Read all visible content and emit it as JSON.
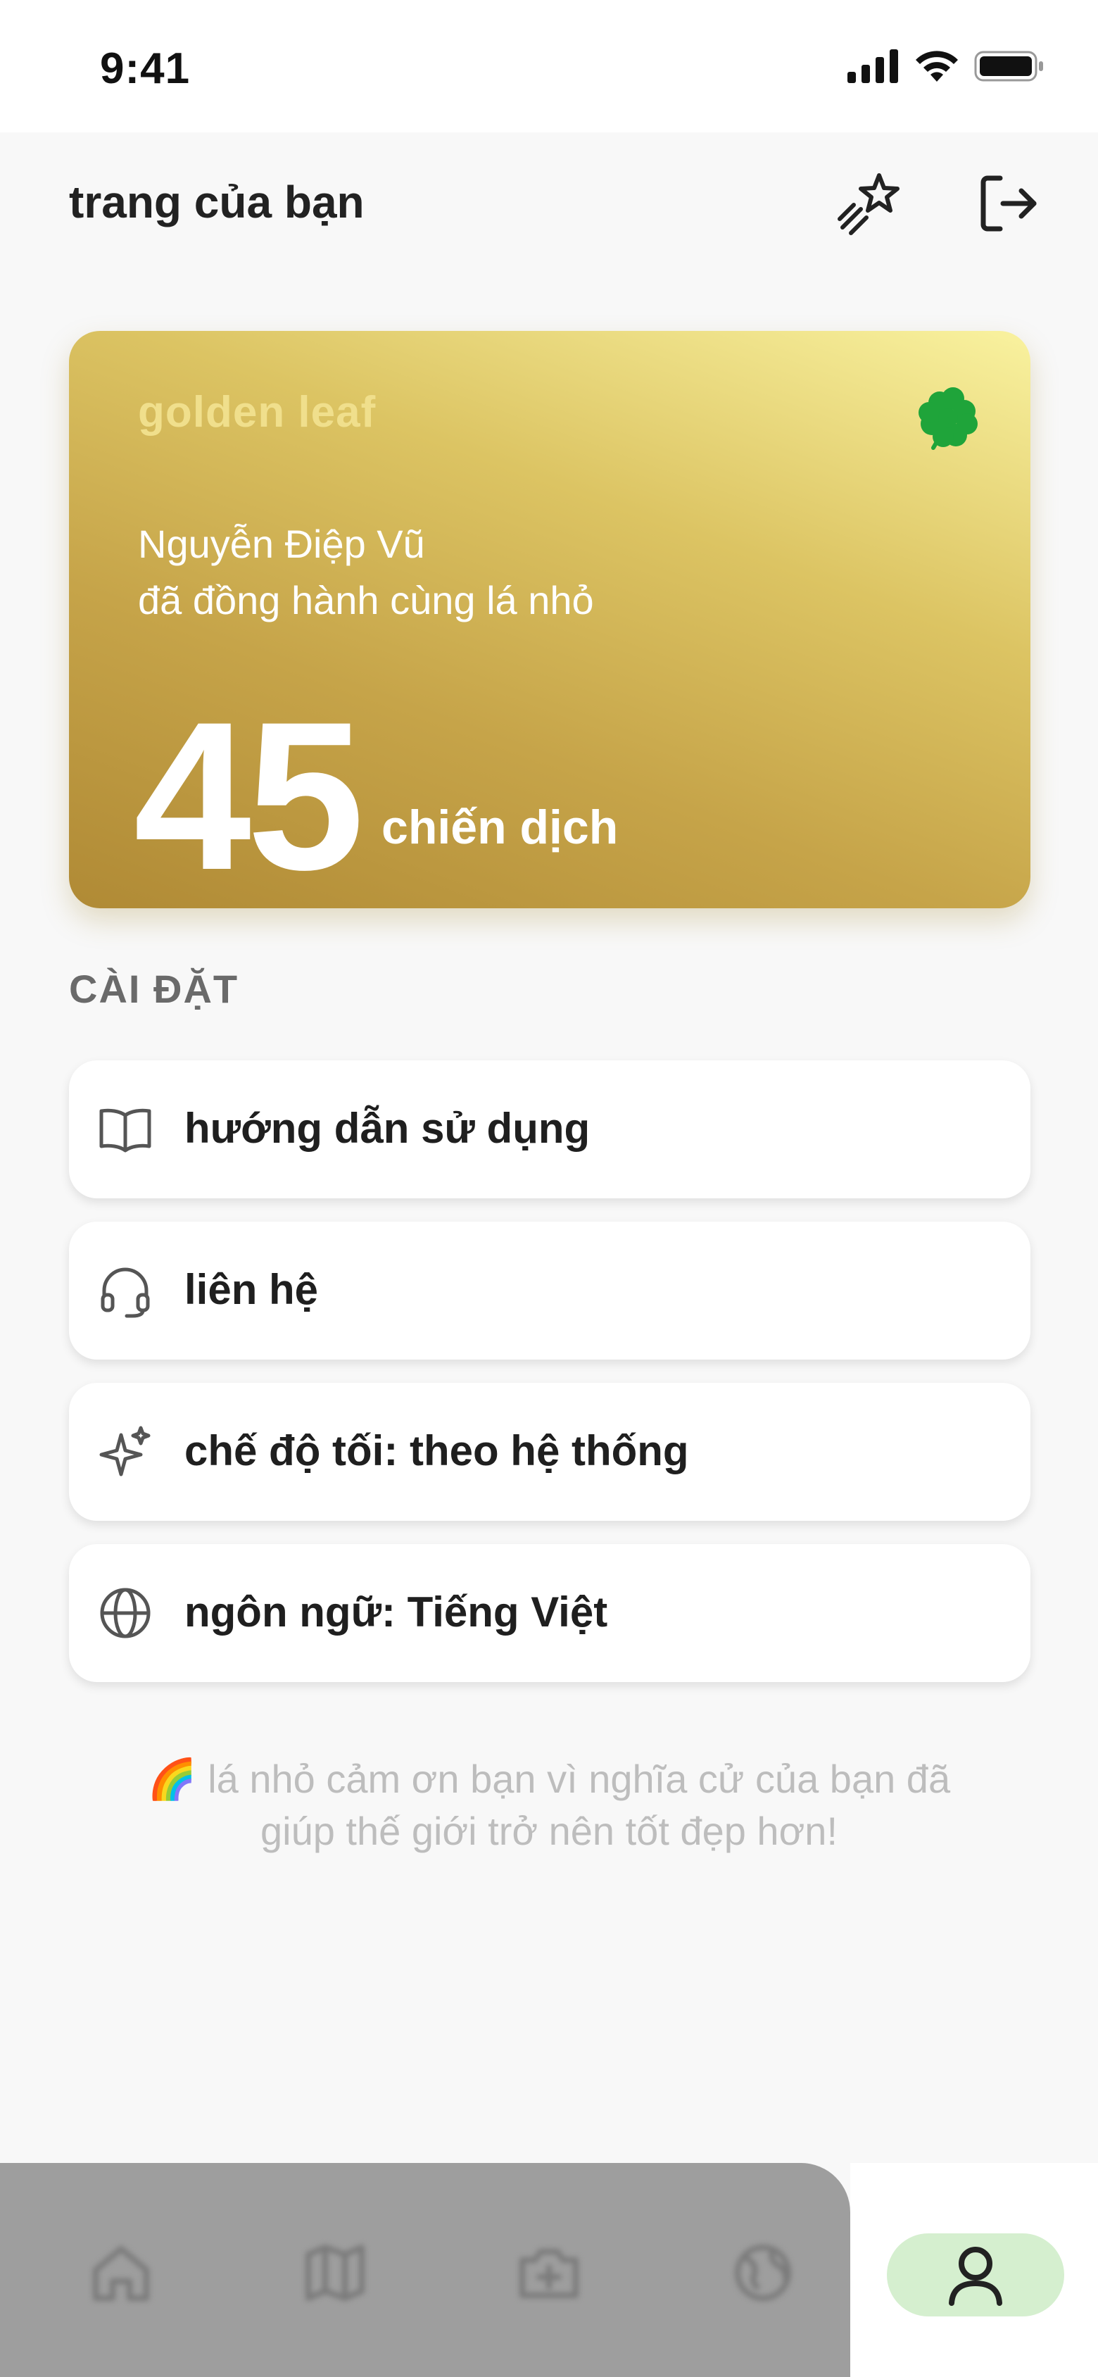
{
  "status_bar": {
    "time": "9:41"
  },
  "header": {
    "title": "trang của bạn"
  },
  "card": {
    "brand": "golden leaf",
    "name_line": "Nguyễn Điệp Vũ",
    "sub_line": "đã đồng hành cùng lá nhỏ",
    "count": "45",
    "unit": "chiến dịch",
    "icon": "four-leaf-clover-icon",
    "accent": "#c6a449"
  },
  "settings": {
    "section_label": "CÀI ĐẶT",
    "items": [
      {
        "label": "hướng dẫn sử dụng",
        "icon": "book-open-icon"
      },
      {
        "label": "liên hệ",
        "icon": "headphones-icon"
      },
      {
        "label": "chế độ tối: theo hệ thống",
        "icon": "sparkles-icon"
      },
      {
        "label": "ngôn ngữ: Tiếng Việt",
        "icon": "globe-icon"
      }
    ]
  },
  "thanks": {
    "emoji": "🌈",
    "line1": "lá nhỏ cảm ơn bạn vì nghĩa cử của bạn đã",
    "line2": "giúp thế giới trở nên tốt đẹp hơn!"
  },
  "bottom_nav": {
    "items": [
      "home-icon",
      "map-icon",
      "camera-plus-icon",
      "globe-earth-icon",
      "user-icon"
    ],
    "active": "user-icon",
    "active_color": "#d5efcf"
  }
}
